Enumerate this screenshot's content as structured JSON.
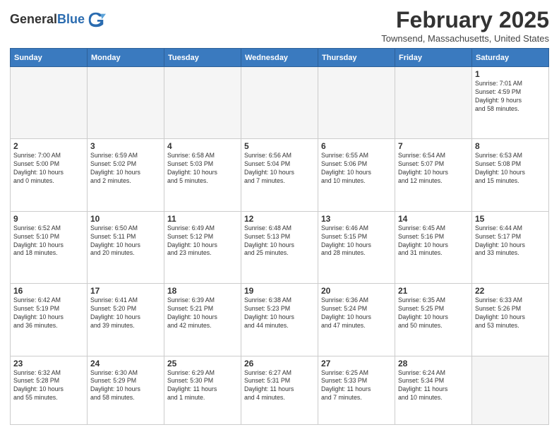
{
  "header": {
    "logo_line1": "General",
    "logo_line2": "Blue",
    "month": "February 2025",
    "location": "Townsend, Massachusetts, United States"
  },
  "weekdays": [
    "Sunday",
    "Monday",
    "Tuesday",
    "Wednesday",
    "Thursday",
    "Friday",
    "Saturday"
  ],
  "weeks": [
    [
      {
        "day": "",
        "info": ""
      },
      {
        "day": "",
        "info": ""
      },
      {
        "day": "",
        "info": ""
      },
      {
        "day": "",
        "info": ""
      },
      {
        "day": "",
        "info": ""
      },
      {
        "day": "",
        "info": ""
      },
      {
        "day": "1",
        "info": "Sunrise: 7:01 AM\nSunset: 4:59 PM\nDaylight: 9 hours\nand 58 minutes."
      }
    ],
    [
      {
        "day": "2",
        "info": "Sunrise: 7:00 AM\nSunset: 5:00 PM\nDaylight: 10 hours\nand 0 minutes."
      },
      {
        "day": "3",
        "info": "Sunrise: 6:59 AM\nSunset: 5:02 PM\nDaylight: 10 hours\nand 2 minutes."
      },
      {
        "day": "4",
        "info": "Sunrise: 6:58 AM\nSunset: 5:03 PM\nDaylight: 10 hours\nand 5 minutes."
      },
      {
        "day": "5",
        "info": "Sunrise: 6:56 AM\nSunset: 5:04 PM\nDaylight: 10 hours\nand 7 minutes."
      },
      {
        "day": "6",
        "info": "Sunrise: 6:55 AM\nSunset: 5:06 PM\nDaylight: 10 hours\nand 10 minutes."
      },
      {
        "day": "7",
        "info": "Sunrise: 6:54 AM\nSunset: 5:07 PM\nDaylight: 10 hours\nand 12 minutes."
      },
      {
        "day": "8",
        "info": "Sunrise: 6:53 AM\nSunset: 5:08 PM\nDaylight: 10 hours\nand 15 minutes."
      }
    ],
    [
      {
        "day": "9",
        "info": "Sunrise: 6:52 AM\nSunset: 5:10 PM\nDaylight: 10 hours\nand 18 minutes."
      },
      {
        "day": "10",
        "info": "Sunrise: 6:50 AM\nSunset: 5:11 PM\nDaylight: 10 hours\nand 20 minutes."
      },
      {
        "day": "11",
        "info": "Sunrise: 6:49 AM\nSunset: 5:12 PM\nDaylight: 10 hours\nand 23 minutes."
      },
      {
        "day": "12",
        "info": "Sunrise: 6:48 AM\nSunset: 5:13 PM\nDaylight: 10 hours\nand 25 minutes."
      },
      {
        "day": "13",
        "info": "Sunrise: 6:46 AM\nSunset: 5:15 PM\nDaylight: 10 hours\nand 28 minutes."
      },
      {
        "day": "14",
        "info": "Sunrise: 6:45 AM\nSunset: 5:16 PM\nDaylight: 10 hours\nand 31 minutes."
      },
      {
        "day": "15",
        "info": "Sunrise: 6:44 AM\nSunset: 5:17 PM\nDaylight: 10 hours\nand 33 minutes."
      }
    ],
    [
      {
        "day": "16",
        "info": "Sunrise: 6:42 AM\nSunset: 5:19 PM\nDaylight: 10 hours\nand 36 minutes."
      },
      {
        "day": "17",
        "info": "Sunrise: 6:41 AM\nSunset: 5:20 PM\nDaylight: 10 hours\nand 39 minutes."
      },
      {
        "day": "18",
        "info": "Sunrise: 6:39 AM\nSunset: 5:21 PM\nDaylight: 10 hours\nand 42 minutes."
      },
      {
        "day": "19",
        "info": "Sunrise: 6:38 AM\nSunset: 5:23 PM\nDaylight: 10 hours\nand 44 minutes."
      },
      {
        "day": "20",
        "info": "Sunrise: 6:36 AM\nSunset: 5:24 PM\nDaylight: 10 hours\nand 47 minutes."
      },
      {
        "day": "21",
        "info": "Sunrise: 6:35 AM\nSunset: 5:25 PM\nDaylight: 10 hours\nand 50 minutes."
      },
      {
        "day": "22",
        "info": "Sunrise: 6:33 AM\nSunset: 5:26 PM\nDaylight: 10 hours\nand 53 minutes."
      }
    ],
    [
      {
        "day": "23",
        "info": "Sunrise: 6:32 AM\nSunset: 5:28 PM\nDaylight: 10 hours\nand 55 minutes."
      },
      {
        "day": "24",
        "info": "Sunrise: 6:30 AM\nSunset: 5:29 PM\nDaylight: 10 hours\nand 58 minutes."
      },
      {
        "day": "25",
        "info": "Sunrise: 6:29 AM\nSunset: 5:30 PM\nDaylight: 11 hours\nand 1 minute."
      },
      {
        "day": "26",
        "info": "Sunrise: 6:27 AM\nSunset: 5:31 PM\nDaylight: 11 hours\nand 4 minutes."
      },
      {
        "day": "27",
        "info": "Sunrise: 6:25 AM\nSunset: 5:33 PM\nDaylight: 11 hours\nand 7 minutes."
      },
      {
        "day": "28",
        "info": "Sunrise: 6:24 AM\nSunset: 5:34 PM\nDaylight: 11 hours\nand 10 minutes."
      },
      {
        "day": "",
        "info": ""
      }
    ]
  ]
}
